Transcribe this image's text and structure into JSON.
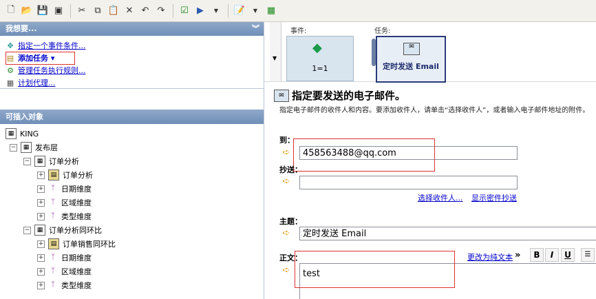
{
  "toolbar": {
    "icons": [
      "new-icon",
      "open-icon",
      "save-icon",
      "save-all-icon",
      "cut-icon",
      "copy-icon",
      "paste-icon",
      "delete-icon",
      "undo-icon",
      "redo-icon",
      "check-icon",
      "run-icon",
      "dropdown-icon",
      "report-icon",
      "dropdown-icon",
      "grid-icon"
    ]
  },
  "left": {
    "actions_header": "我想要...",
    "actions": [
      {
        "label": "指定一个事件条件..."
      },
      {
        "label": "添加任务 ▾"
      },
      {
        "label": "管理任务执行规则..."
      },
      {
        "label": "计划代理..."
      }
    ],
    "objects_header": "可插入对象",
    "tree": [
      {
        "label": "KING"
      },
      {
        "label": "发布层"
      },
      {
        "label": "订单分析"
      },
      {
        "label": "订单分析"
      },
      {
        "label": "日期维度"
      },
      {
        "label": "区域维度"
      },
      {
        "label": "类型维度"
      },
      {
        "label": "订单分析同环比"
      },
      {
        "label": "订单销售同环比"
      },
      {
        "label": "日期维度"
      },
      {
        "label": "区域维度"
      },
      {
        "label": "类型维度"
      }
    ]
  },
  "right": {
    "event_label": "事件:",
    "task_label": "任务:",
    "event_card_text": "1=1",
    "task_card_text": "定时发送 Email",
    "section_title": "指定要发送的电子邮件。",
    "description": "指定电子邮件的收件人和内容。要添加收件人，请单击“选择收件人”，或者输入电子邮件地址的附件。",
    "to_label": "到：",
    "to_value": "458563488@qq.com",
    "cc_label": "抄送：",
    "cc_value": "",
    "select_recipients": "选择收件人...",
    "show_bcc": "显示密件抄送",
    "subject_label": "主题：",
    "subject_value": "定时发送 Email",
    "body_label": "正文：",
    "plain_text_link": "更改为纯文本",
    "body_value": "test",
    "format_buttons": [
      "B",
      "I",
      "U"
    ]
  },
  "colors": {
    "panel_header": "#7f9cc2",
    "highlight_red": "#e03030",
    "link_blue": "#0000cc"
  }
}
